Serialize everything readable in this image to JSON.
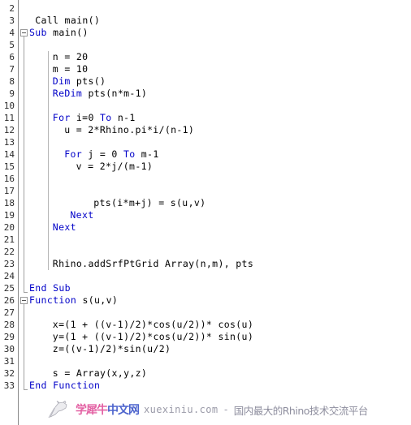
{
  "editor": {
    "language": "VBScript",
    "first_visible_line": 2,
    "last_visible_line": 33,
    "colors": {
      "background": "#ffffff",
      "text": "#000000",
      "keyword": "#0000c8",
      "gutter_text": "#2c2c2c",
      "gutter_rule": "#888888",
      "fold_marker": "#999999",
      "indent_guide": "#b5b5b5"
    }
  },
  "gutter": {
    "line_numbers": [
      2,
      3,
      4,
      5,
      6,
      7,
      8,
      9,
      10,
      11,
      12,
      13,
      14,
      15,
      16,
      17,
      18,
      19,
      20,
      21,
      22,
      23,
      24,
      25,
      26,
      27,
      28,
      29,
      30,
      31,
      32,
      33
    ]
  },
  "fold_markers": [
    {
      "line": 4,
      "state": "expanded",
      "glyph": "minus-box-icon"
    },
    {
      "line": 26,
      "state": "expanded",
      "glyph": "minus-box-icon"
    }
  ],
  "lines": [
    {
      "n": 2,
      "indent": 0,
      "tokens": []
    },
    {
      "n": 3,
      "indent": 1,
      "tokens": [
        {
          "t": "Call main()",
          "k": "pl"
        }
      ]
    },
    {
      "n": 4,
      "indent": 0,
      "tokens": [
        {
          "t": "Sub",
          "k": "kw"
        },
        {
          "t": " main()",
          "k": "pl"
        }
      ]
    },
    {
      "n": 5,
      "indent": 0,
      "tokens": []
    },
    {
      "n": 6,
      "indent": 4,
      "tokens": [
        {
          "t": "n = 20",
          "k": "pl"
        }
      ]
    },
    {
      "n": 7,
      "indent": 4,
      "tokens": [
        {
          "t": "m = 10",
          "k": "pl"
        }
      ]
    },
    {
      "n": 8,
      "indent": 4,
      "tokens": [
        {
          "t": "Dim",
          "k": "kw"
        },
        {
          "t": " pts()",
          "k": "pl"
        }
      ]
    },
    {
      "n": 9,
      "indent": 4,
      "tokens": [
        {
          "t": "ReDim",
          "k": "kw"
        },
        {
          "t": " pts(n*m-1)",
          "k": "pl"
        }
      ]
    },
    {
      "n": 10,
      "indent": 0,
      "tokens": []
    },
    {
      "n": 11,
      "indent": 4,
      "tokens": [
        {
          "t": "For",
          "k": "kw"
        },
        {
          "t": " i=0 ",
          "k": "pl"
        },
        {
          "t": "To",
          "k": "kw"
        },
        {
          "t": " n-1",
          "k": "pl"
        }
      ]
    },
    {
      "n": 12,
      "indent": 6,
      "tokens": [
        {
          "t": "u = 2*Rhino.pi*i/(n-1)",
          "k": "pl"
        }
      ]
    },
    {
      "n": 13,
      "indent": 0,
      "tokens": []
    },
    {
      "n": 14,
      "indent": 6,
      "tokens": [
        {
          "t": "For",
          "k": "kw"
        },
        {
          "t": " j = 0 ",
          "k": "pl"
        },
        {
          "t": "To",
          "k": "kw"
        },
        {
          "t": " m-1",
          "k": "pl"
        }
      ]
    },
    {
      "n": 15,
      "indent": 8,
      "tokens": [
        {
          "t": "v = 2*j/(m-1)",
          "k": "pl"
        }
      ]
    },
    {
      "n": 16,
      "indent": 0,
      "tokens": []
    },
    {
      "n": 17,
      "indent": 0,
      "tokens": []
    },
    {
      "n": 18,
      "indent": 11,
      "tokens": [
        {
          "t": "pts(i*m+j) = s(u,v)",
          "k": "pl"
        }
      ]
    },
    {
      "n": 19,
      "indent": 7,
      "tokens": [
        {
          "t": "Next",
          "k": "kw"
        }
      ]
    },
    {
      "n": 20,
      "indent": 4,
      "tokens": [
        {
          "t": "Next",
          "k": "kw"
        }
      ]
    },
    {
      "n": 21,
      "indent": 0,
      "tokens": []
    },
    {
      "n": 22,
      "indent": 0,
      "tokens": []
    },
    {
      "n": 23,
      "indent": 4,
      "tokens": [
        {
          "t": "Rhino.addSrfPtGrid Array(n,m), pts",
          "k": "pl"
        }
      ]
    },
    {
      "n": 24,
      "indent": 0,
      "tokens": []
    },
    {
      "n": 25,
      "indent": 0,
      "tokens": [
        {
          "t": "End Sub",
          "k": "kw"
        }
      ]
    },
    {
      "n": 26,
      "indent": 0,
      "tokens": [
        {
          "t": "Function",
          "k": "kw"
        },
        {
          "t": " s(u,v)",
          "k": "pl"
        }
      ]
    },
    {
      "n": 27,
      "indent": 0,
      "tokens": []
    },
    {
      "n": 28,
      "indent": 4,
      "tokens": [
        {
          "t": "x=(1 + ((v-1)/2)*cos(u/2))* cos(u)",
          "k": "pl"
        }
      ]
    },
    {
      "n": 29,
      "indent": 4,
      "tokens": [
        {
          "t": "y=(1 + ((v-1)/2)*cos(u/2))* sin(u)",
          "k": "pl"
        }
      ]
    },
    {
      "n": 30,
      "indent": 4,
      "tokens": [
        {
          "t": "z=((v-1)/2)*sin(u/2)",
          "k": "pl"
        }
      ]
    },
    {
      "n": 31,
      "indent": 0,
      "tokens": []
    },
    {
      "n": 32,
      "indent": 4,
      "tokens": [
        {
          "t": "s = Array(x,y,z)",
          "k": "pl"
        }
      ]
    },
    {
      "n": 33,
      "indent": 0,
      "tokens": [
        {
          "t": "End Function",
          "k": "kw"
        }
      ]
    }
  ],
  "watermark": {
    "logo": "rhino-head-logo",
    "brand_pink": "学犀牛",
    "brand_blue": "中文网",
    "domain": "xuexiniu.com",
    "dash": "-",
    "tagline": "国内最大的Rhino技术交流平台",
    "colors": {
      "pink": "#e0519a",
      "blue": "#3a54c8",
      "gray": "#9a9aa8"
    }
  }
}
